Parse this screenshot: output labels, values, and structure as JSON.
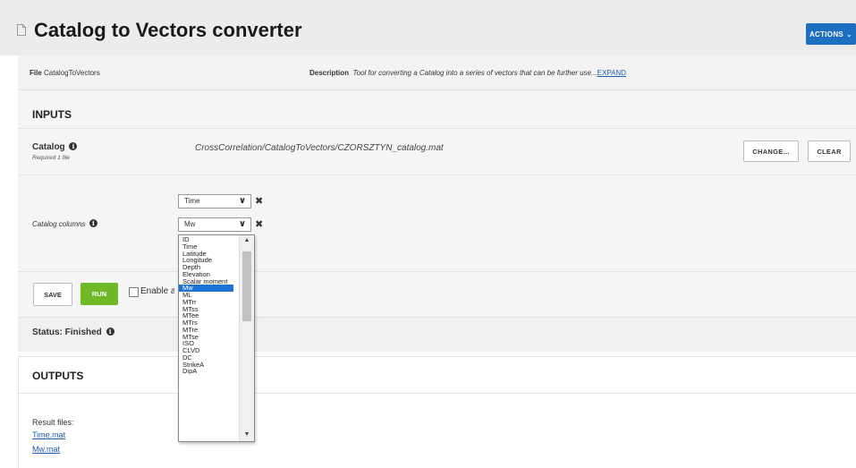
{
  "header": {
    "title": "Catalog to Vectors converter",
    "actions_label": "ACTIONS"
  },
  "info": {
    "file_label": "File",
    "file_value": "CatalogToVectors",
    "description_label": "Description",
    "description_value": "Tool for converting a Catalog into a series of vectors that can be further use...",
    "expand_label": "EXPAND"
  },
  "inputs": {
    "section_title": "INPUTS",
    "catalog": {
      "label": "Catalog",
      "hint": "Required 1 file",
      "path": "CrossCorrelation/CatalogToVectors/CZORSZTYN_catalog.mat",
      "change_label": "CHANGE...",
      "clear_label": "CLEAR"
    },
    "catalog_columns": {
      "label": "Catalog columns",
      "selected": [
        "Time",
        "Mw"
      ]
    }
  },
  "dropdown": {
    "options": [
      "ID",
      "Time",
      "Latitude",
      "Longitude",
      "Depth",
      "Elevation",
      "Scalar moment",
      "Mw",
      "ML",
      "MTrr",
      "MTss",
      "MTee",
      "MTrs",
      "MTre",
      "MTse",
      "ISO",
      "CLVD",
      "DC",
      "StrikeA",
      "DipA"
    ],
    "highlighted": "Mw"
  },
  "controls": {
    "save_label": "SAVE",
    "run_label": "RUN",
    "enable_label": "Enable a"
  },
  "status": {
    "text": "Status: Finished"
  },
  "outputs": {
    "section_title": "OUTPUTS",
    "result_label": "Result files:",
    "files": [
      "Time.mat",
      "Mw.mat"
    ]
  },
  "colors": {
    "primary": "#1f6fc0",
    "run": "#6fb828",
    "highlight": "#1e73d6",
    "link": "#1f5fb0"
  }
}
